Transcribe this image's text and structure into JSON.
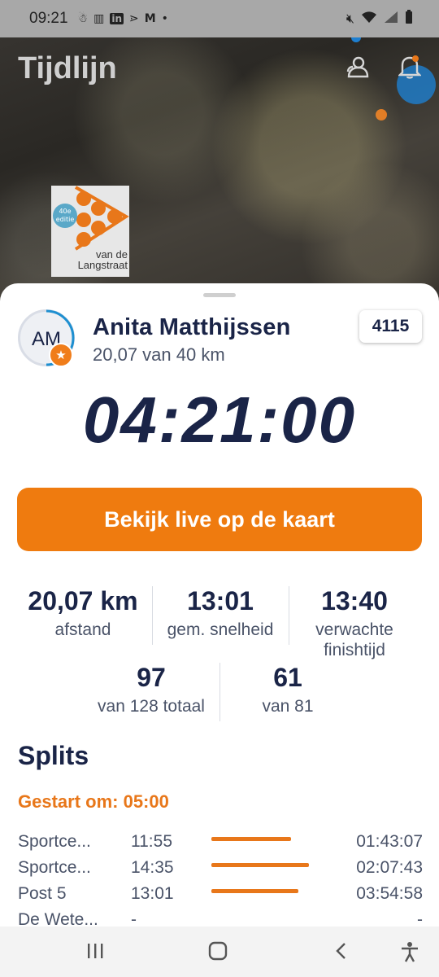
{
  "status_bar": {
    "time": "09:21",
    "left_icons": [
      "notification-icon",
      "audio-icon",
      "linkedin-icon",
      "app-icon",
      "gmail-icon",
      "dot-icon"
    ],
    "right_icons": [
      "mute-icon",
      "wifi-icon",
      "signal-icon",
      "battery-icon"
    ]
  },
  "app": {
    "title": "Tijdlijn",
    "logo_badge": "40e editie",
    "logo_text": "van de Langstraat"
  },
  "runner": {
    "initials": "AM",
    "name": "Anita Matthijssen",
    "distance": "20,07 van 40 km",
    "bib": "4115",
    "elapsed": "04:21:00"
  },
  "live_button": "Bekijk live op de kaart",
  "stats": [
    {
      "value": "20,07 km",
      "label": "afstand"
    },
    {
      "value": "13:01",
      "label": "gem. snelheid"
    },
    {
      "value": "13:40",
      "label": "verwachte finishtijd"
    },
    {
      "value": "97",
      "label": "van 128 totaal"
    },
    {
      "value": "61",
      "label": "van 81"
    }
  ],
  "splits": {
    "title": "Splits",
    "started": "Gestart om: 05:00",
    "rows": [
      {
        "name": "Sportce...",
        "pace": "11:55",
        "bar_fraction": 0.82,
        "time": "01:43:07"
      },
      {
        "name": "Sportce...",
        "pace": "14:35",
        "bar_fraction": 1.0,
        "time": "02:07:43"
      },
      {
        "name": "Post 5",
        "pace": "13:01",
        "bar_fraction": 0.89,
        "time": "03:54:58"
      },
      {
        "name": "De Wete...",
        "pace": "-",
        "bar_fraction": 0,
        "time": "-"
      }
    ]
  },
  "colors": {
    "accent": "#ef7b0f",
    "navy": "#1a2447"
  }
}
